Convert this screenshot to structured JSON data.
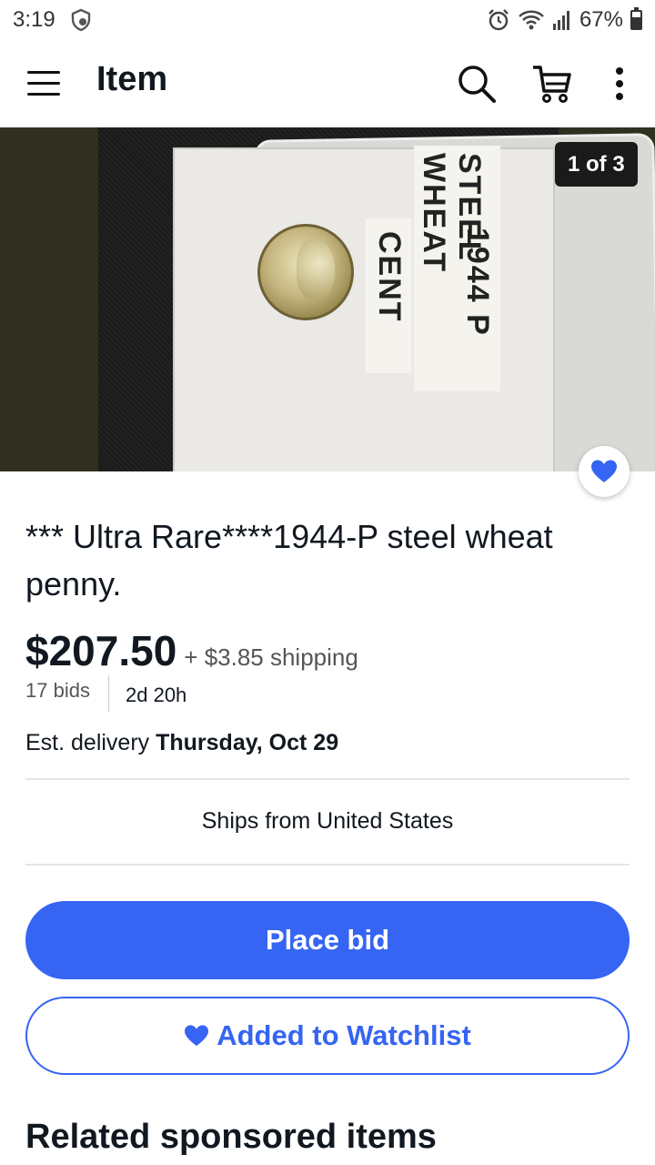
{
  "status_bar": {
    "time": "3:19",
    "battery": "67%",
    "battery_level": 0.67,
    "icons": [
      "shield-icon",
      "alarm-icon",
      "wifi-icon",
      "signal-icon",
      "battery-icon"
    ]
  },
  "header": {
    "title": "Item",
    "icons": [
      "menu-icon",
      "search-icon",
      "cart-icon",
      "more-vert-icon"
    ]
  },
  "gallery": {
    "counter": "1 of 3",
    "photo_label_1": "CENT",
    "photo_label_2": "1944 P",
    "photo_label_3": "STEEL WHEAT"
  },
  "item": {
    "title": "*** Ultra Rare****1944-P steel wheat penny.",
    "price": "$207.50",
    "shipping": "+ $3.85 shipping",
    "bids": "17 bids",
    "time_left": "2d 20h",
    "delivery_prefix": "Est. delivery ",
    "delivery_date": "Thursday, Oct 29",
    "ships_from": "Ships from United States"
  },
  "actions": {
    "place_bid": "Place bid",
    "watchlist": "Added to Watchlist"
  },
  "related": {
    "heading": "Related sponsored items"
  },
  "colors": {
    "accent": "#3665f3",
    "text": "#111820"
  }
}
